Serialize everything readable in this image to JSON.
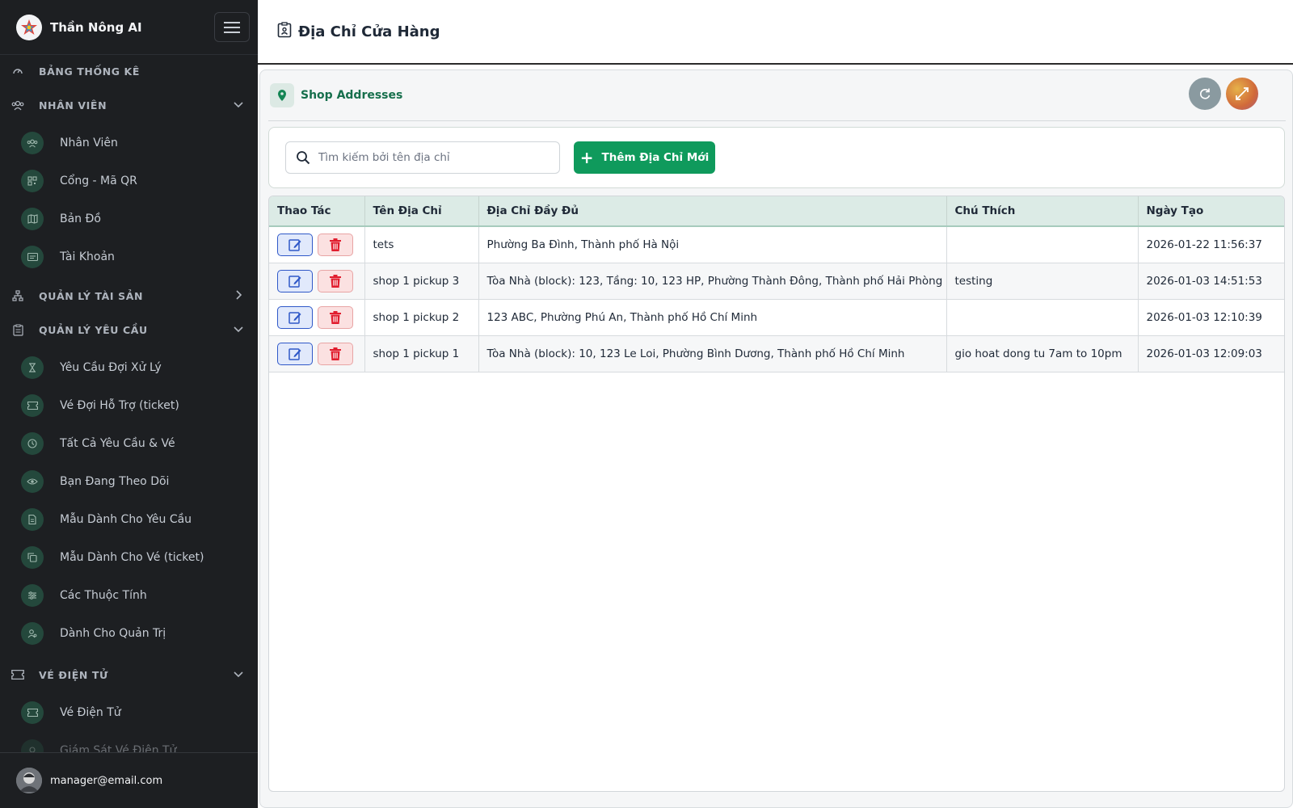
{
  "app": {
    "name": "Thần Nông AI"
  },
  "sidebar": {
    "sections": [
      {
        "label": "BẢNG THỐNG KÊ",
        "icon": "dashboard-icon",
        "expanded": null
      },
      {
        "label": "NHÂN VIÊN",
        "icon": "team-icon",
        "expanded": true
      },
      {
        "label": "QUẢN LÝ TÀI SẢN",
        "icon": "hierarchy-icon",
        "expanded": false
      },
      {
        "label": "QUẢN LÝ YÊU CẦU",
        "icon": "clipboard-icon",
        "expanded": true
      },
      {
        "label": "VÉ ĐIỆN TỬ",
        "icon": "ticket-icon",
        "expanded": true
      }
    ],
    "employee_items": [
      {
        "label": "Nhân Viên",
        "icon": "team-icon"
      },
      {
        "label": "Cổng - Mã QR",
        "icon": "qr-icon"
      },
      {
        "label": "Bản Đồ",
        "icon": "map-icon"
      },
      {
        "label": "Tài Khoản",
        "icon": "id-card-icon"
      }
    ],
    "request_items": [
      {
        "label": "Yêu Cầu Đợi Xử Lý",
        "icon": "hourglass-icon"
      },
      {
        "label": "Vé Đợi Hỗ Trợ (ticket)",
        "icon": "ticket-icon"
      },
      {
        "label": "Tất Cả Yêu Cầu & Vé",
        "icon": "history-icon"
      },
      {
        "label": "Bạn Đang Theo Dõi",
        "icon": "eye-icon"
      },
      {
        "label": "Mẫu Dành Cho Yêu Cầu",
        "icon": "document-icon"
      },
      {
        "label": "Mẫu Dành Cho Vé (ticket)",
        "icon": "copy-icon"
      },
      {
        "label": "Các Thuộc Tính",
        "icon": "sliders-icon"
      },
      {
        "label": "Dành Cho Quản Trị",
        "icon": "admin-user-icon"
      }
    ],
    "eticket_items": [
      {
        "label": "Vé Điện Tử",
        "icon": "ticket-icon"
      },
      {
        "label": "Giám Sát Vé Điện Tử",
        "icon": "monitor-icon"
      }
    ],
    "user_email": "manager@email.com"
  },
  "page": {
    "title": "Địa Chỉ Cửa Hàng"
  },
  "panel": {
    "title": "Shop Addresses"
  },
  "toolbar": {
    "search_placeholder": "Tìm kiếm bởi tên địa chỉ",
    "add_label": "Thêm Địa Chỉ Mới"
  },
  "table": {
    "columns": [
      "Thao Tác",
      "Tên Địa Chỉ",
      "Địa Chỉ Đầy Đủ",
      "Chú Thích",
      "Ngày Tạo"
    ],
    "rows": [
      {
        "name": "tets",
        "address": "Phường Ba Đình, Thành phố Hà Nội",
        "note": "",
        "created": "2026-01-22 11:56:37"
      },
      {
        "name": "shop 1 pickup 3",
        "address": "Tòa Nhà (block): 123, Tầng: 10, 123 HP, Phường Thành Đông, Thành phố Hải Phòng",
        "note": "testing",
        "created": "2026-01-03 14:51:53"
      },
      {
        "name": "shop 1 pickup 2",
        "address": "123 ABC, Phường Phú An, Thành phố Hồ Chí Minh",
        "note": "",
        "created": "2026-01-03 12:10:39"
      },
      {
        "name": "shop 1 pickup 1",
        "address": "Tòa Nhà (block): 10, 123 Le Loi, Phường Bình Dương, Thành phố Hồ Chí Minh",
        "note": "gio hoat dong tu 7am to 10pm",
        "created": "2026-01-03 12:09:03"
      }
    ]
  },
  "colors": {
    "sidebar_bg": "#1d1f22",
    "accent": "#0f9a5c",
    "header_bg": "#dcebe6"
  }
}
